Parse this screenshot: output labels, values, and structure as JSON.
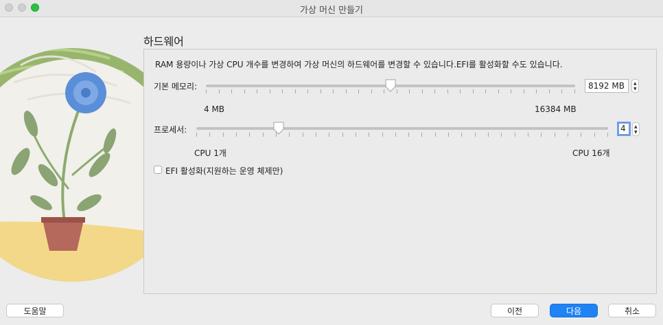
{
  "window": {
    "title": "가상 머신 만들기"
  },
  "section": {
    "title": "하드웨어"
  },
  "description": "RAM 용량이나 가상 CPU 개수를 변경하여 가상 머신의 하드웨어를 변경할 수 있습니다.EFI를 활성화할 수도 있습니다.",
  "memory": {
    "label": "기본 메모리:",
    "value": "8192 MB",
    "min_label": "4 MB",
    "max_label": "16384 MB",
    "min": 4,
    "max": 16384,
    "current": 8192
  },
  "processor": {
    "label": "프로세서:",
    "value": "4",
    "min_label": "CPU 1개",
    "max_label": "CPU 16개",
    "min": 1,
    "max": 16,
    "current": 4
  },
  "efi": {
    "label": "EFI 활성화(지원하는 운영 체제만)",
    "checked": false
  },
  "buttons": {
    "help": "도움말",
    "back": "이전",
    "next": "다음",
    "cancel": "취소"
  },
  "colors": {
    "accent": "#1f82f5",
    "focus": "#6e9ee6"
  }
}
